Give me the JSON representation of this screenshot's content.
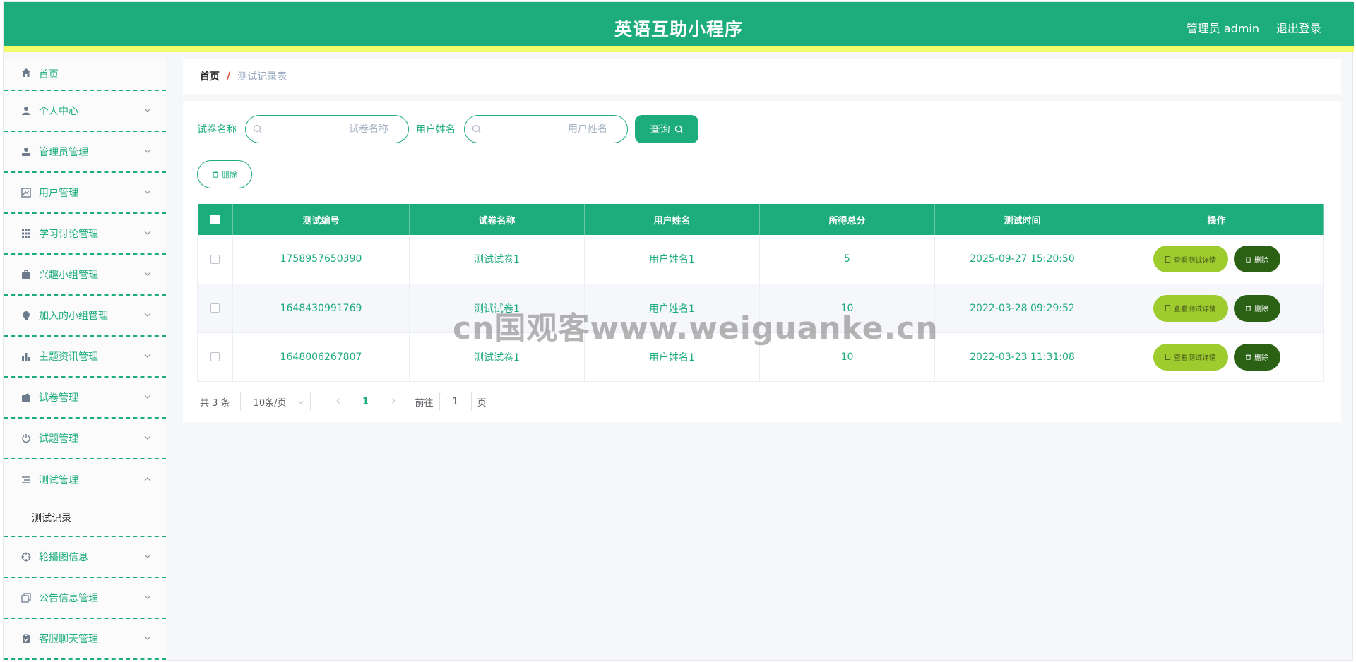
{
  "header": {
    "title": "英语互助小程序",
    "user": "管理员 admin",
    "logout": "退出登录"
  },
  "sidebar": {
    "items": [
      {
        "label": "首页",
        "icon": "home-icon"
      },
      {
        "label": "个人中心",
        "icon": "user-icon"
      },
      {
        "label": "管理员管理",
        "icon": "admin-icon"
      },
      {
        "label": "用户管理",
        "icon": "trend-icon"
      },
      {
        "label": "学习讨论管理",
        "icon": "grid-icon"
      },
      {
        "label": "兴趣小组管理",
        "icon": "briefcase-icon"
      },
      {
        "label": "加入的小组管理",
        "icon": "bulb-icon"
      },
      {
        "label": "主题资讯管理",
        "icon": "bar-chart-icon"
      },
      {
        "label": "试卷管理",
        "icon": "wallet-icon"
      },
      {
        "label": "试题管理",
        "icon": "power-icon"
      },
      {
        "label": "测试管理",
        "icon": "list-icon"
      },
      {
        "label": "轮播图信息",
        "icon": "target-icon"
      },
      {
        "label": "公告信息管理",
        "icon": "copy-icon"
      },
      {
        "label": "客服聊天管理",
        "icon": "clipboard-icon"
      }
    ],
    "submenu": {
      "label": "测试记录"
    }
  },
  "breadcrumb": {
    "home": "首页",
    "separator": "/",
    "current": "测试记录表"
  },
  "search": {
    "paper_label": "试卷名称",
    "paper_placeholder": "试卷名称",
    "user_label": "用户姓名",
    "user_placeholder": "用户姓名",
    "query_button": "查询"
  },
  "actions": {
    "batch_delete": "删除"
  },
  "table": {
    "headers": [
      "测试编号",
      "试卷名称",
      "用户姓名",
      "所得总分",
      "测试时间",
      "操作"
    ],
    "rows": [
      {
        "id": "1758957650390",
        "paper": "测试试卷1",
        "user": "用户姓名1",
        "score": "5",
        "time": "2025-09-27 15:20:50"
      },
      {
        "id": "1648430991769",
        "paper": "测试试卷1",
        "user": "用户姓名1",
        "score": "10",
        "time": "2022-03-28 09:29:52"
      },
      {
        "id": "1648006267807",
        "paper": "测试试卷1",
        "user": "用户姓名1",
        "score": "10",
        "time": "2022-03-23 11:31:08"
      }
    ],
    "detail_button": "查看测试详情",
    "delete_button": "删除"
  },
  "pagination": {
    "total": "共 3 条",
    "page_size": "10条/页",
    "current_page": "1",
    "goto_label": "前往",
    "goto_value": "1",
    "page_suffix": "页"
  },
  "watermark": "cn国观客www.weiguanke.cn",
  "colors": {
    "primary": "#1dac7b",
    "accent_bar": "#f4fb68",
    "detail_button": "#9ecb2d",
    "delete_button": "#2b6115"
  }
}
